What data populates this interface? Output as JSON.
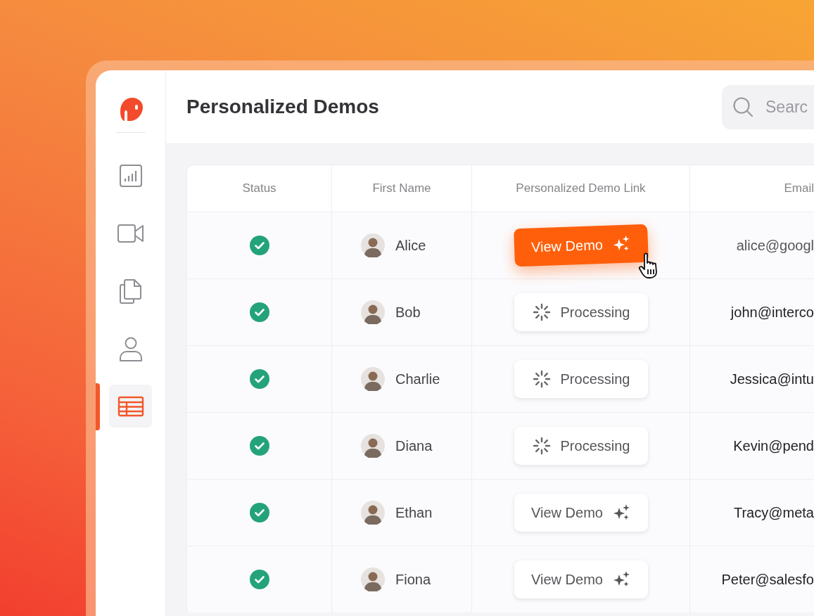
{
  "page": {
    "title": "Personalized Demos",
    "search": {
      "placeholder": "Searc"
    }
  },
  "sidebar": {
    "items": [
      {
        "kind": "chart",
        "selected": false
      },
      {
        "kind": "video",
        "selected": false
      },
      {
        "kind": "files",
        "selected": false
      },
      {
        "kind": "person",
        "selected": false
      },
      {
        "kind": "table",
        "selected": true
      }
    ]
  },
  "table": {
    "columns": [
      "Status",
      "First Name",
      "Personalized Demo Link",
      "Email"
    ],
    "rows": [
      {
        "checked": true,
        "first_name": "Alice",
        "link": {
          "kind": "view",
          "label": "View Demo",
          "highlighted": true
        },
        "email": "alice@googl"
      },
      {
        "checked": true,
        "first_name": "Bob",
        "link": {
          "kind": "processing",
          "label": "Processing",
          "highlighted": false
        },
        "email": "john@interco"
      },
      {
        "checked": true,
        "first_name": "Charlie",
        "link": {
          "kind": "processing",
          "label": "Processing",
          "highlighted": false
        },
        "email": "Jessica@intu"
      },
      {
        "checked": true,
        "first_name": "Diana",
        "link": {
          "kind": "processing",
          "label": "Processing",
          "highlighted": false
        },
        "email": "Kevin@pend"
      },
      {
        "checked": true,
        "first_name": "Ethan",
        "link": {
          "kind": "view",
          "label": "View Demo",
          "highlighted": false
        },
        "email": "Tracy@meta"
      },
      {
        "checked": true,
        "first_name": "Fiona",
        "link": {
          "kind": "view",
          "label": "View Demo",
          "highlighted": false
        },
        "email": "Peter@salesfo"
      }
    ]
  }
}
